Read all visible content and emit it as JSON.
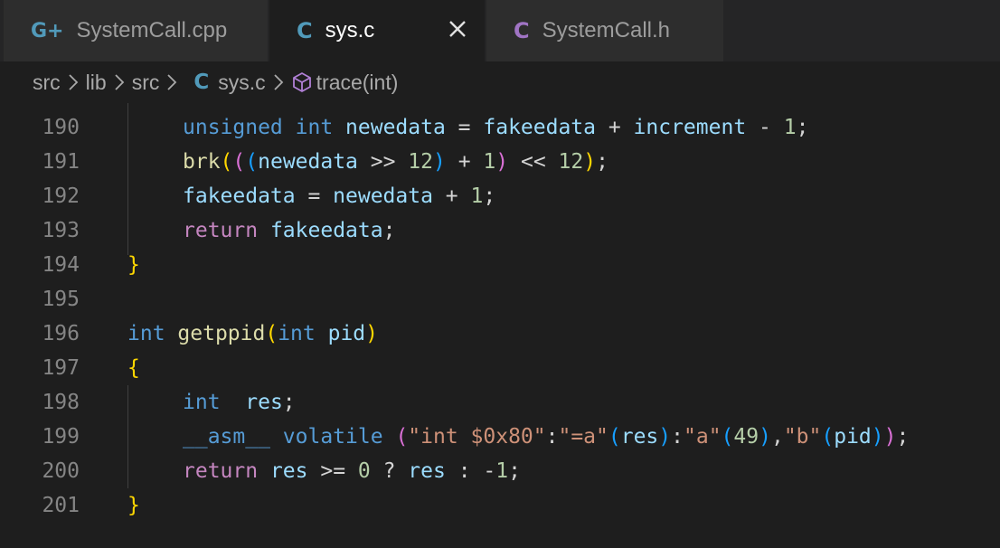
{
  "tabs": [
    {
      "label": "SystemCall.cpp",
      "icon": "C-plus-icon",
      "icon_glyph": "G+",
      "icon_color": "#519aba",
      "active": false
    },
    {
      "label": "sys.c",
      "icon": "c-file-icon",
      "icon_glyph": "C",
      "icon_color": "#519aba",
      "active": true
    },
    {
      "label": "SystemCall.h",
      "icon": "header-file-icon",
      "icon_glyph": "C",
      "icon_color": "#a074c4",
      "active": false
    }
  ],
  "breadcrumb": {
    "parts": [
      "src",
      "lib",
      "src"
    ],
    "file_icon": "C",
    "file": "sys.c",
    "symbol": "trace(int)"
  },
  "editor": {
    "lines": [
      {
        "num": "190",
        "indent": 1,
        "tokens": [
          [
            "kw",
            "unsigned"
          ],
          [
            "op",
            " "
          ],
          [
            "kw",
            "int"
          ],
          [
            "op",
            " "
          ],
          [
            "var",
            "newedata"
          ],
          [
            "op",
            " = "
          ],
          [
            "var",
            "fakeedata"
          ],
          [
            "op",
            " + "
          ],
          [
            "var",
            "increment"
          ],
          [
            "op",
            " - "
          ],
          [
            "num",
            "1"
          ],
          [
            "op",
            ";"
          ]
        ]
      },
      {
        "num": "191",
        "indent": 1,
        "tokens": [
          [
            "fn",
            "brk"
          ],
          [
            "b1",
            "("
          ],
          [
            "b2",
            "("
          ],
          [
            "b3",
            "("
          ],
          [
            "var",
            "newedata"
          ],
          [
            "op",
            " >> "
          ],
          [
            "num",
            "12"
          ],
          [
            "b3",
            ")"
          ],
          [
            "op",
            " + "
          ],
          [
            "num",
            "1"
          ],
          [
            "b2",
            ")"
          ],
          [
            "op",
            " << "
          ],
          [
            "num",
            "12"
          ],
          [
            "b1",
            ")"
          ],
          [
            "op",
            ";"
          ]
        ]
      },
      {
        "num": "192",
        "indent": 1,
        "tokens": [
          [
            "var",
            "fakeedata"
          ],
          [
            "op",
            " = "
          ],
          [
            "var",
            "newedata"
          ],
          [
            "op",
            " + "
          ],
          [
            "num",
            "1"
          ],
          [
            "op",
            ";"
          ]
        ]
      },
      {
        "num": "193",
        "indent": 1,
        "tokens": [
          [
            "ctrl",
            "return"
          ],
          [
            "op",
            " "
          ],
          [
            "var",
            "fakeedata"
          ],
          [
            "op",
            ";"
          ]
        ]
      },
      {
        "num": "194",
        "indent": 0,
        "tokens": [
          [
            "b1",
            "}"
          ]
        ]
      },
      {
        "num": "195",
        "indent": 0,
        "tokens": []
      },
      {
        "num": "196",
        "indent": 0,
        "tokens": [
          [
            "kw",
            "int"
          ],
          [
            "op",
            " "
          ],
          [
            "fn",
            "getppid"
          ],
          [
            "b1",
            "("
          ],
          [
            "kw",
            "int"
          ],
          [
            "op",
            " "
          ],
          [
            "var",
            "pid"
          ],
          [
            "b1",
            ")"
          ]
        ]
      },
      {
        "num": "197",
        "indent": 0,
        "tokens": [
          [
            "b1",
            "{"
          ]
        ]
      },
      {
        "num": "198",
        "indent": 1,
        "tokens": [
          [
            "kw",
            "int"
          ],
          [
            "op",
            "  "
          ],
          [
            "var",
            "res"
          ],
          [
            "op",
            ";"
          ]
        ]
      },
      {
        "num": "199",
        "indent": 1,
        "tokens": [
          [
            "kw",
            "__asm__"
          ],
          [
            "op",
            " "
          ],
          [
            "kw",
            "volatile"
          ],
          [
            "op",
            " "
          ],
          [
            "b2",
            "("
          ],
          [
            "str",
            "\"int $0x80\""
          ],
          [
            "op",
            ":"
          ],
          [
            "str",
            "\"=a\""
          ],
          [
            "b3",
            "("
          ],
          [
            "var",
            "res"
          ],
          [
            "b3",
            ")"
          ],
          [
            "op",
            ":"
          ],
          [
            "str",
            "\"a\""
          ],
          [
            "b3",
            "("
          ],
          [
            "num",
            "49"
          ],
          [
            "b3",
            ")"
          ],
          [
            "op",
            ","
          ],
          [
            "str",
            "\"b\""
          ],
          [
            "b3",
            "("
          ],
          [
            "var",
            "pid"
          ],
          [
            "b3",
            ")"
          ],
          [
            "b2",
            ")"
          ],
          [
            "op",
            ";"
          ]
        ]
      },
      {
        "num": "200",
        "indent": 1,
        "tokens": [
          [
            "ctrl",
            "return"
          ],
          [
            "op",
            " "
          ],
          [
            "var",
            "res"
          ],
          [
            "op",
            " >= "
          ],
          [
            "num",
            "0"
          ],
          [
            "op",
            " ? "
          ],
          [
            "var",
            "res"
          ],
          [
            "op",
            " : "
          ],
          [
            "op",
            "-"
          ],
          [
            "num",
            "1"
          ],
          [
            "op",
            ";"
          ]
        ]
      },
      {
        "num": "201",
        "indent": 0,
        "tokens": [
          [
            "b1",
            "}"
          ]
        ]
      }
    ]
  }
}
